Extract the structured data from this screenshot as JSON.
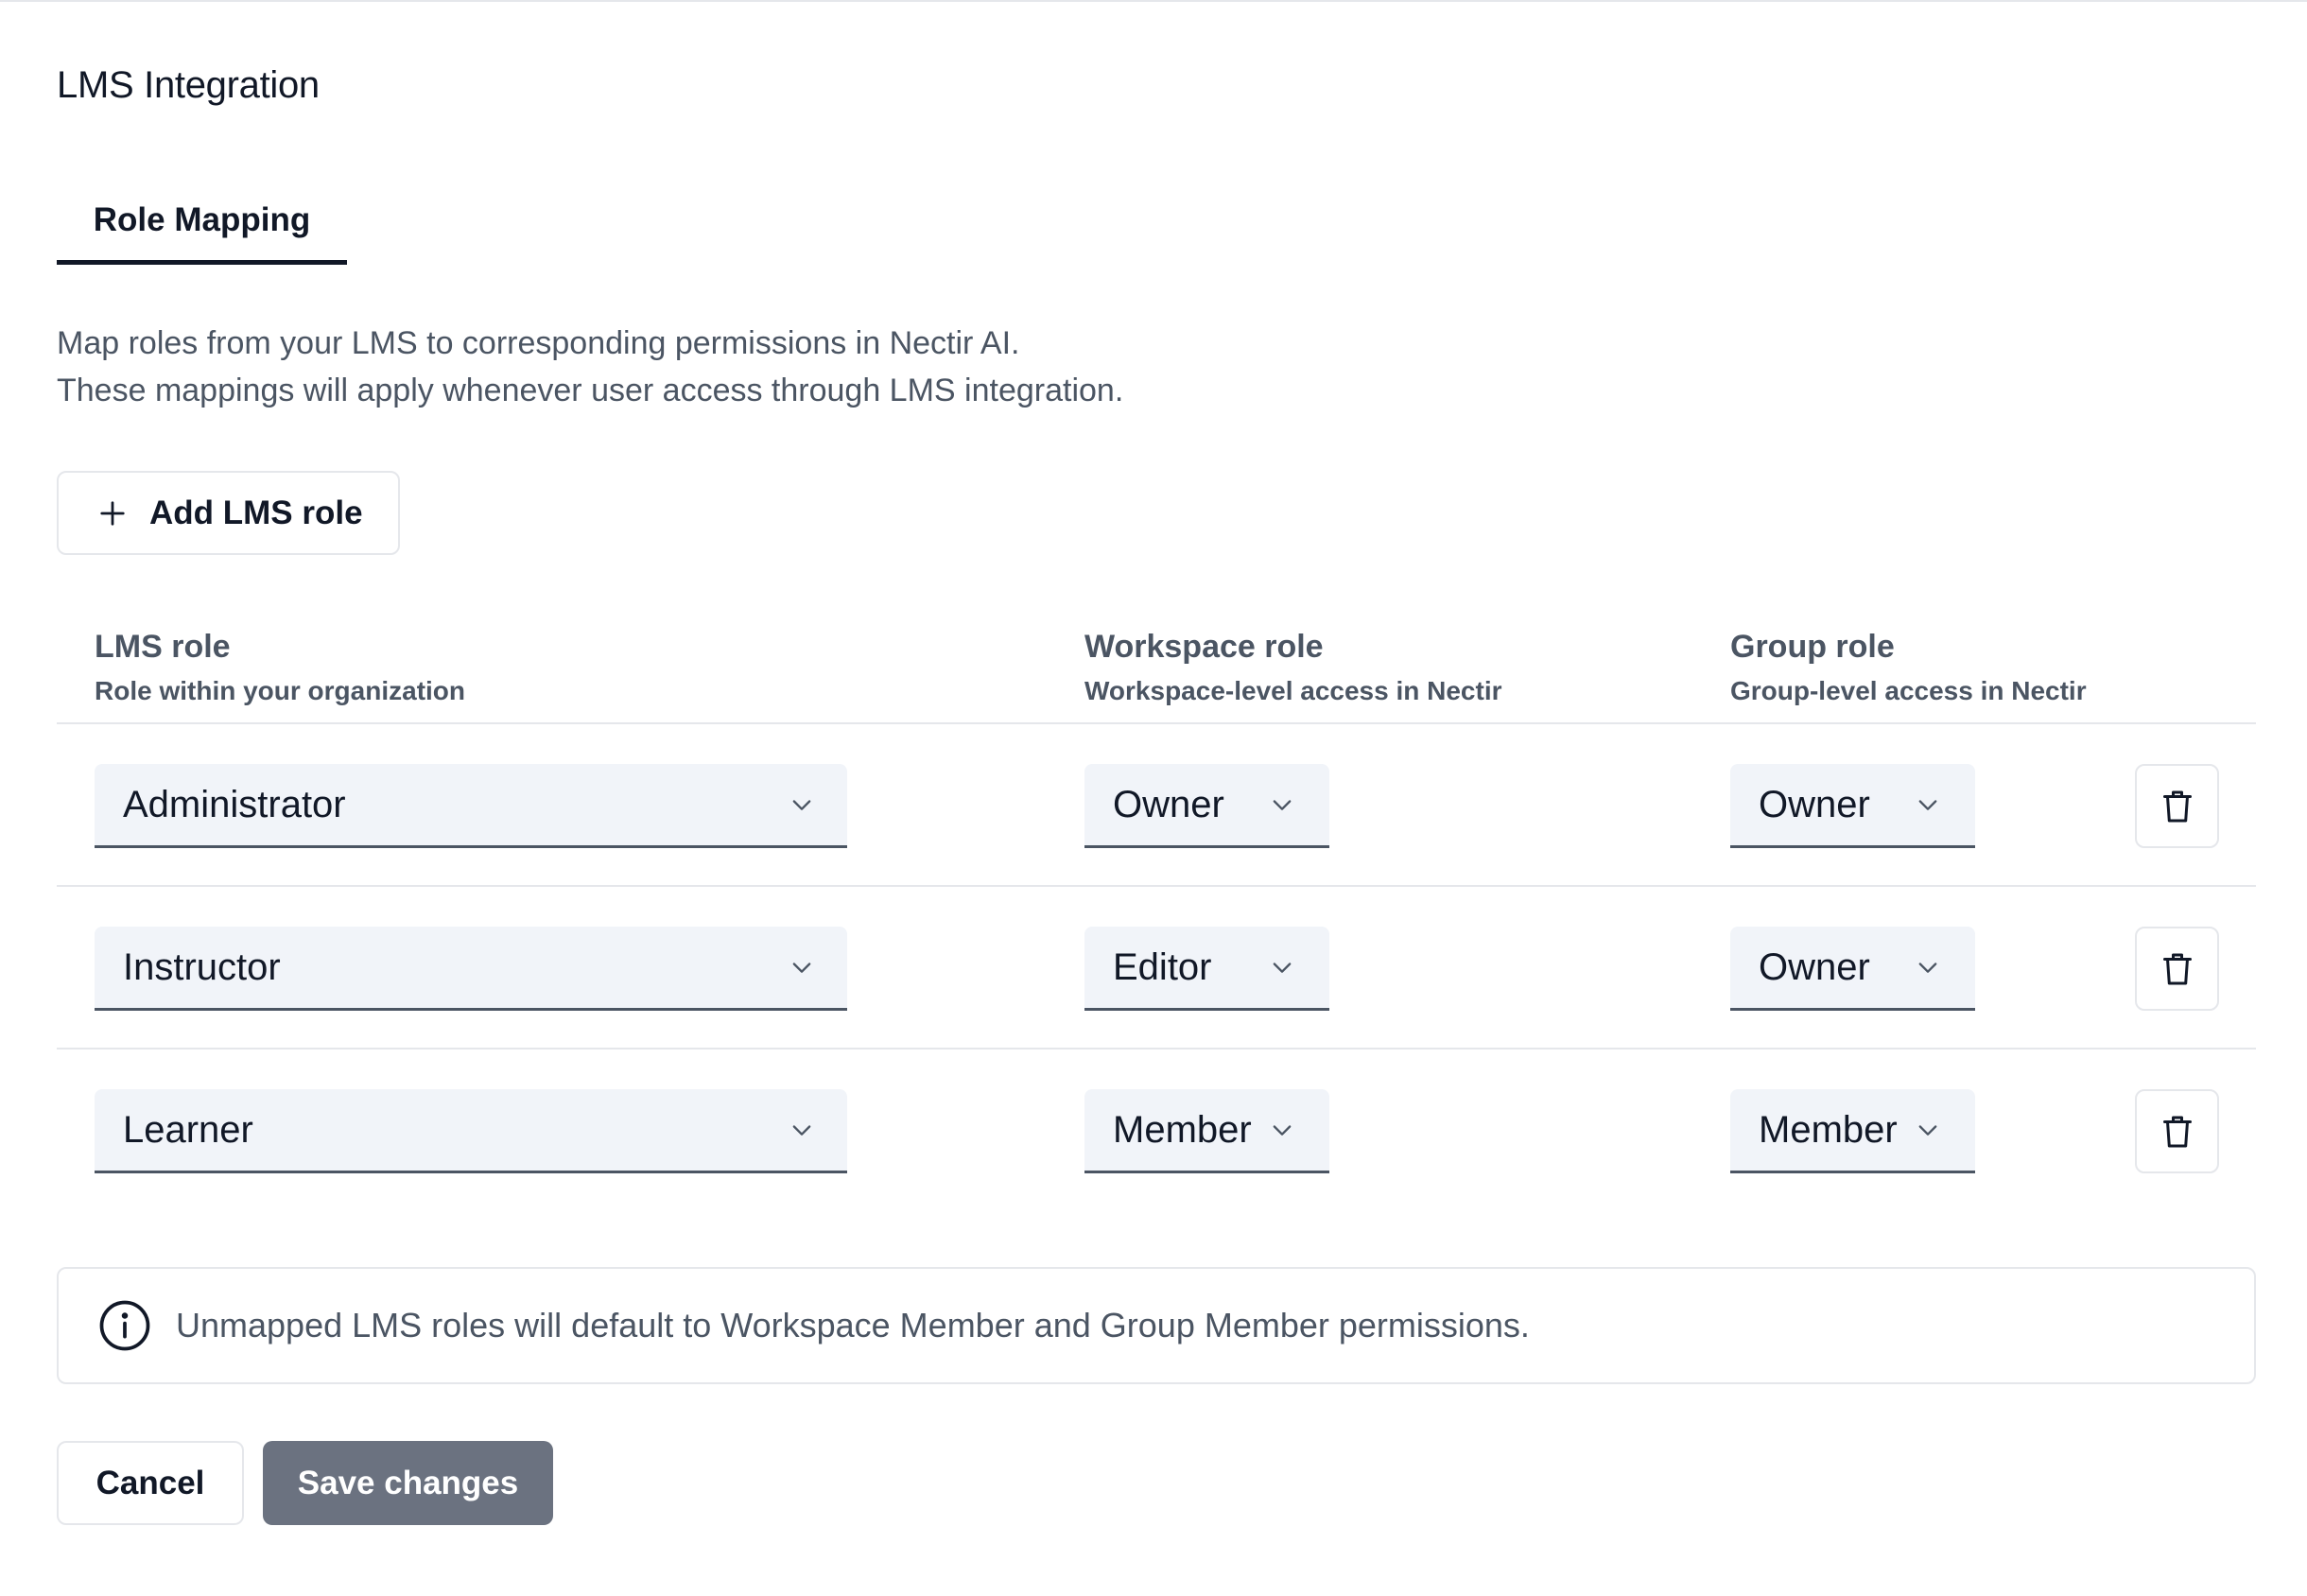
{
  "page": {
    "title": "LMS Integration"
  },
  "tabs": [
    {
      "label": "Role Mapping",
      "active": true
    }
  ],
  "description": {
    "line1": "Map roles from your LMS to corresponding permissions in Nectir AI.",
    "line2": "These mappings will apply whenever user access through LMS integration."
  },
  "add_button": {
    "label": "Add LMS role",
    "icon": "plus-icon"
  },
  "columns": {
    "lms": {
      "title": "LMS role",
      "subtitle": "Role within your organization"
    },
    "workspace": {
      "title": "Workspace role",
      "subtitle": "Workspace-level access in Nectir"
    },
    "group": {
      "title": "Group role",
      "subtitle": "Group-level access in Nectir"
    }
  },
  "rows": [
    {
      "lms_role": "Administrator",
      "workspace_role": "Owner",
      "group_role": "Owner"
    },
    {
      "lms_role": "Instructor",
      "workspace_role": "Editor",
      "group_role": "Owner"
    },
    {
      "lms_role": "Learner",
      "workspace_role": "Member",
      "group_role": "Member"
    }
  ],
  "row_icons": {
    "select": "chevron-down-icon",
    "delete": "trash-icon"
  },
  "notice": {
    "icon": "info-icon",
    "text": "Unmapped LMS roles will default to Workspace Member and Group Member permissions."
  },
  "actions": {
    "cancel_label": "Cancel",
    "save_label": "Save changes"
  },
  "colors": {
    "text_primary": "#111827",
    "text_secondary": "#4b5563",
    "border": "#e5e7eb",
    "select_bg": "#f1f4f9",
    "save_button_bg": "#6b7280"
  }
}
